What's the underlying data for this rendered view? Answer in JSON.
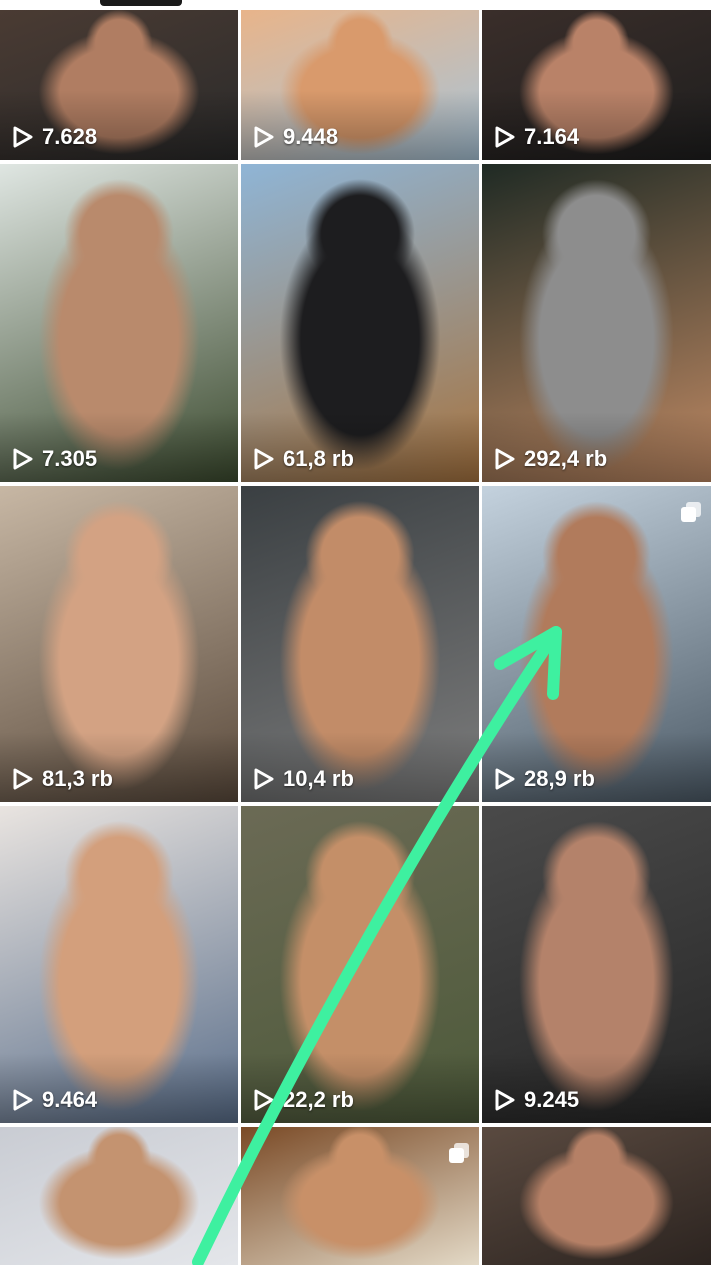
{
  "grid": {
    "tiles": [
      {
        "views": "7.628",
        "icon": "play-icon",
        "multi": false,
        "palette": [
          "#4a3b33",
          "#b07d62",
          "#2a2a2a"
        ]
      },
      {
        "views": "9.448",
        "icon": "play-icon",
        "multi": false,
        "palette": [
          "#e8b48a",
          "#d99a6c",
          "#a8c4d8"
        ]
      },
      {
        "views": "7.164",
        "icon": "play-icon",
        "multi": false,
        "palette": [
          "#3a2e2a",
          "#b98268",
          "#1e1e1e"
        ]
      },
      {
        "views": "7.305",
        "icon": "play-icon",
        "multi": false,
        "palette": [
          "#dfe6e2",
          "#b98a6c",
          "#3b4a2e"
        ]
      },
      {
        "views": "61,8 rb",
        "icon": "play-icon",
        "multi": false,
        "palette": [
          "#8fb5d6",
          "#1d1d1f",
          "#a6733f"
        ]
      },
      {
        "views": "292,4 rb",
        "icon": "play-icon",
        "multi": false,
        "palette": [
          "#1f2a24",
          "#8d8d8d",
          "#c08a64"
        ]
      },
      {
        "views": "81,3 rb",
        "icon": "play-icon",
        "multi": false,
        "palette": [
          "#c7b7a4",
          "#d3a283",
          "#5a4a3c"
        ]
      },
      {
        "views": "10,4 rb",
        "icon": "play-icon",
        "multi": false,
        "palette": [
          "#3a3f42",
          "#c28c68",
          "#7d7d7d"
        ]
      },
      {
        "views": "28,9 rb",
        "icon": "play-icon",
        "multi": true,
        "palette": [
          "#c4d2de",
          "#b17b5c",
          "#4c5a66"
        ]
      },
      {
        "views": "9.464",
        "icon": "play-icon",
        "multi": false,
        "palette": [
          "#e9e4e0",
          "#d39f7c",
          "#5a6e8a"
        ]
      },
      {
        "views": "22,2 rb",
        "icon": "play-icon",
        "multi": false,
        "palette": [
          "#6b6a55",
          "#c48f68",
          "#4d5a3a"
        ]
      },
      {
        "views": "9.245",
        "icon": "play-icon",
        "multi": false,
        "palette": [
          "#4a4a4a",
          "#b4826a",
          "#262626"
        ]
      },
      {
        "views": "",
        "icon": "",
        "multi": false,
        "palette": [
          "#c9ccd3",
          "#c49370",
          "#e4e6ea"
        ]
      },
      {
        "views": "",
        "icon": "",
        "multi": true,
        "palette": [
          "#7a4a26",
          "#c89068",
          "#e3d9c6"
        ]
      },
      {
        "views": "",
        "icon": "",
        "multi": false,
        "palette": [
          "#5a4a40",
          "#b58066",
          "#2c2420"
        ]
      }
    ]
  },
  "overlay": {
    "arrow_color": "#3ef0a0"
  }
}
